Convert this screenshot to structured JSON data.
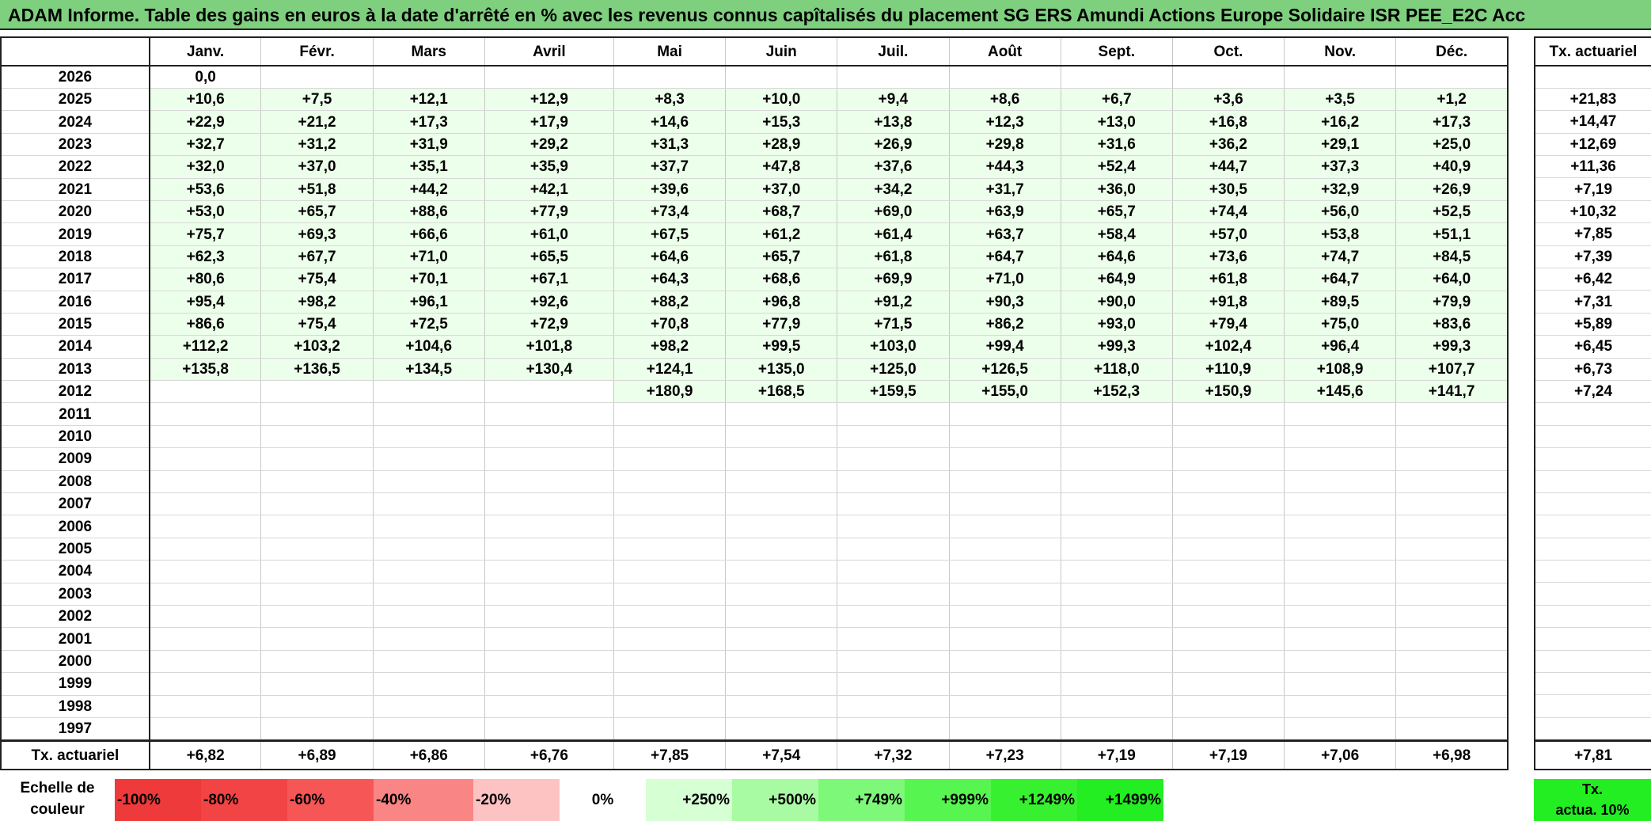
{
  "title": "ADAM Informe. Table des gains en euros à la date d'arrêté en % avec les revenus connus capîtalisés du placement SG ERS Amundi Actions Europe Solidaire ISR PEE_E2C Acc",
  "months": [
    "Janv.",
    "Févr.",
    "Mars",
    "Avril",
    "Mai",
    "Juin",
    "Juil.",
    "Août",
    "Sept.",
    "Oct.",
    "Nov.",
    "Déc."
  ],
  "side_header": "Tx. actuariel",
  "rows": [
    {
      "year": "2026",
      "values": [
        "0,0",
        "",
        "",
        "",
        "",
        "",
        "",
        "",
        "",
        "",
        "",
        ""
      ],
      "tx": ""
    },
    {
      "year": "2025",
      "values": [
        "+10,6",
        "+7,5",
        "+12,1",
        "+12,9",
        "+8,3",
        "+10,0",
        "+9,4",
        "+8,6",
        "+6,7",
        "+3,6",
        "+3,5",
        "+1,2"
      ],
      "tx": "+21,83"
    },
    {
      "year": "2024",
      "values": [
        "+22,9",
        "+21,2",
        "+17,3",
        "+17,9",
        "+14,6",
        "+15,3",
        "+13,8",
        "+12,3",
        "+13,0",
        "+16,8",
        "+16,2",
        "+17,3"
      ],
      "tx": "+14,47"
    },
    {
      "year": "2023",
      "values": [
        "+32,7",
        "+31,2",
        "+31,9",
        "+29,2",
        "+31,3",
        "+28,9",
        "+26,9",
        "+29,8",
        "+31,6",
        "+36,2",
        "+29,1",
        "+25,0"
      ],
      "tx": "+12,69"
    },
    {
      "year": "2022",
      "values": [
        "+32,0",
        "+37,0",
        "+35,1",
        "+35,9",
        "+37,7",
        "+47,8",
        "+37,6",
        "+44,3",
        "+52,4",
        "+44,7",
        "+37,3",
        "+40,9"
      ],
      "tx": "+11,36"
    },
    {
      "year": "2021",
      "values": [
        "+53,6",
        "+51,8",
        "+44,2",
        "+42,1",
        "+39,6",
        "+37,0",
        "+34,2",
        "+31,7",
        "+36,0",
        "+30,5",
        "+32,9",
        "+26,9"
      ],
      "tx": "+7,19"
    },
    {
      "year": "2020",
      "values": [
        "+53,0",
        "+65,7",
        "+88,6",
        "+77,9",
        "+73,4",
        "+68,7",
        "+69,0",
        "+63,9",
        "+65,7",
        "+74,4",
        "+56,0",
        "+52,5"
      ],
      "tx": "+10,32"
    },
    {
      "year": "2019",
      "values": [
        "+75,7",
        "+69,3",
        "+66,6",
        "+61,0",
        "+67,5",
        "+61,2",
        "+61,4",
        "+63,7",
        "+58,4",
        "+57,0",
        "+53,8",
        "+51,1"
      ],
      "tx": "+7,85"
    },
    {
      "year": "2018",
      "values": [
        "+62,3",
        "+67,7",
        "+71,0",
        "+65,5",
        "+64,6",
        "+65,7",
        "+61,8",
        "+64,7",
        "+64,6",
        "+73,6",
        "+74,7",
        "+84,5"
      ],
      "tx": "+7,39"
    },
    {
      "year": "2017",
      "values": [
        "+80,6",
        "+75,4",
        "+70,1",
        "+67,1",
        "+64,3",
        "+68,6",
        "+69,9",
        "+71,0",
        "+64,9",
        "+61,8",
        "+64,7",
        "+64,0"
      ],
      "tx": "+6,42"
    },
    {
      "year": "2016",
      "values": [
        "+95,4",
        "+98,2",
        "+96,1",
        "+92,6",
        "+88,2",
        "+96,8",
        "+91,2",
        "+90,3",
        "+90,0",
        "+91,8",
        "+89,5",
        "+79,9"
      ],
      "tx": "+7,31"
    },
    {
      "year": "2015",
      "values": [
        "+86,6",
        "+75,4",
        "+72,5",
        "+72,9",
        "+70,8",
        "+77,9",
        "+71,5",
        "+86,2",
        "+93,0",
        "+79,4",
        "+75,0",
        "+83,6"
      ],
      "tx": "+5,89"
    },
    {
      "year": "2014",
      "values": [
        "+112,2",
        "+103,2",
        "+104,6",
        "+101,8",
        "+98,2",
        "+99,5",
        "+103,0",
        "+99,4",
        "+99,3",
        "+102,4",
        "+96,4",
        "+99,3"
      ],
      "tx": "+6,45"
    },
    {
      "year": "2013",
      "values": [
        "+135,8",
        "+136,5",
        "+134,5",
        "+130,4",
        "+124,1",
        "+135,0",
        "+125,0",
        "+126,5",
        "+118,0",
        "+110,9",
        "+108,9",
        "+107,7"
      ],
      "tx": "+6,73"
    },
    {
      "year": "2012",
      "values": [
        "",
        "",
        "",
        "",
        "+180,9",
        "+168,5",
        "+159,5",
        "+155,0",
        "+152,3",
        "+150,9",
        "+145,6",
        "+141,7"
      ],
      "tx": "+7,24"
    },
    {
      "year": "2011",
      "values": [
        "",
        "",
        "",
        "",
        "",
        "",
        "",
        "",
        "",
        "",
        "",
        ""
      ],
      "tx": ""
    },
    {
      "year": "2010",
      "values": [
        "",
        "",
        "",
        "",
        "",
        "",
        "",
        "",
        "",
        "",
        "",
        ""
      ],
      "tx": ""
    },
    {
      "year": "2009",
      "values": [
        "",
        "",
        "",
        "",
        "",
        "",
        "",
        "",
        "",
        "",
        "",
        ""
      ],
      "tx": ""
    },
    {
      "year": "2008",
      "values": [
        "",
        "",
        "",
        "",
        "",
        "",
        "",
        "",
        "",
        "",
        "",
        ""
      ],
      "tx": ""
    },
    {
      "year": "2007",
      "values": [
        "",
        "",
        "",
        "",
        "",
        "",
        "",
        "",
        "",
        "",
        "",
        ""
      ],
      "tx": ""
    },
    {
      "year": "2006",
      "values": [
        "",
        "",
        "",
        "",
        "",
        "",
        "",
        "",
        "",
        "",
        "",
        ""
      ],
      "tx": ""
    },
    {
      "year": "2005",
      "values": [
        "",
        "",
        "",
        "",
        "",
        "",
        "",
        "",
        "",
        "",
        "",
        ""
      ],
      "tx": ""
    },
    {
      "year": "2004",
      "values": [
        "",
        "",
        "",
        "",
        "",
        "",
        "",
        "",
        "",
        "",
        "",
        ""
      ],
      "tx": ""
    },
    {
      "year": "2003",
      "values": [
        "",
        "",
        "",
        "",
        "",
        "",
        "",
        "",
        "",
        "",
        "",
        ""
      ],
      "tx": ""
    },
    {
      "year": "2002",
      "values": [
        "",
        "",
        "",
        "",
        "",
        "",
        "",
        "",
        "",
        "",
        "",
        ""
      ],
      "tx": ""
    },
    {
      "year": "2001",
      "values": [
        "",
        "",
        "",
        "",
        "",
        "",
        "",
        "",
        "",
        "",
        "",
        ""
      ],
      "tx": ""
    },
    {
      "year": "2000",
      "values": [
        "",
        "",
        "",
        "",
        "",
        "",
        "",
        "",
        "",
        "",
        "",
        ""
      ],
      "tx": ""
    },
    {
      "year": "1999",
      "values": [
        "",
        "",
        "",
        "",
        "",
        "",
        "",
        "",
        "",
        "",
        "",
        ""
      ],
      "tx": ""
    },
    {
      "year": "1998",
      "values": [
        "",
        "",
        "",
        "",
        "",
        "",
        "",
        "",
        "",
        "",
        "",
        ""
      ],
      "tx": ""
    },
    {
      "year": "1997",
      "values": [
        "",
        "",
        "",
        "",
        "",
        "",
        "",
        "",
        "",
        "",
        "",
        ""
      ],
      "tx": ""
    }
  ],
  "summary": {
    "label": "Tx. actuariel",
    "values": [
      "+6,82",
      "+6,89",
      "+6,86",
      "+6,76",
      "+7,85",
      "+7,54",
      "+7,32",
      "+7,23",
      "+7,19",
      "+7,19",
      "+7,06",
      "+6,98"
    ],
    "total": "+7,81"
  },
  "legend": {
    "label_line1": "Echelle de",
    "label_line2": "couleur",
    "swatches": [
      {
        "label": "-100%",
        "color": "#ee3a3a",
        "kind": "neg"
      },
      {
        "label": "-80%",
        "color": "#f24444",
        "kind": "neg"
      },
      {
        "label": "-60%",
        "color": "#f65656",
        "kind": "neg"
      },
      {
        "label": "-40%",
        "color": "#fa8585",
        "kind": "neg"
      },
      {
        "label": "-20%",
        "color": "#fdc3c3",
        "kind": "neg"
      },
      {
        "label": "0%",
        "color": "#ffffff",
        "kind": "zero"
      },
      {
        "label": "+250%",
        "color": "#d6ffd3",
        "kind": "pos"
      },
      {
        "label": "+500%",
        "color": "#a9fba3",
        "kind": "pos"
      },
      {
        "label": "+749%",
        "color": "#7ef879",
        "kind": "pos"
      },
      {
        "label": "+999%",
        "color": "#56f54f",
        "kind": "pos"
      },
      {
        "label": "+1249%",
        "color": "#37f130",
        "kind": "pos"
      },
      {
        "label": "+1499%",
        "color": "#22ee22",
        "kind": "pos"
      }
    ],
    "tx_line1": "Tx.",
    "tx_line2": "actua. 10%"
  }
}
